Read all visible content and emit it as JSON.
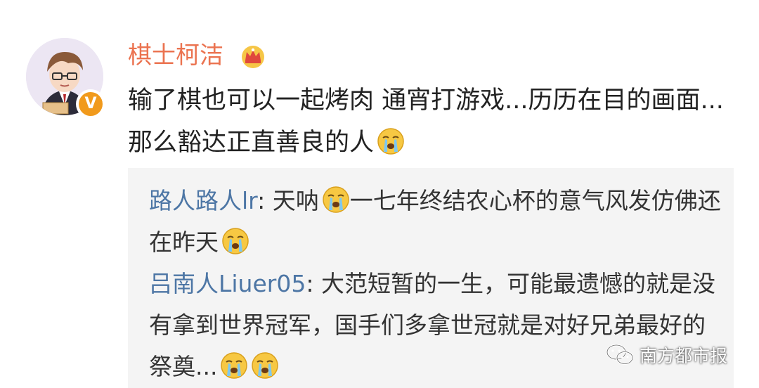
{
  "post": {
    "author": "棋士柯洁",
    "text_1": "输了棋也可以一起烤肉 通宵打游戏...历历在目的画面...那么豁达正直善良的人",
    "verified_mark": "V",
    "emoji_after_text": "crying-emoji"
  },
  "replies": [
    {
      "user": "路人路人lr",
      "sep": ": ",
      "text_a": "天呐",
      "text_b": "一七年终结农心杯的意气风发仿佛还在昨天"
    },
    {
      "user": "吕南人Liuer05",
      "sep": ": ",
      "text_a": "大范短暂的一生，可能最遗憾的就是没有拿到世界冠军，国手们多拿世冠就是对好兄弟最好的祭奠..."
    }
  ],
  "watermark": {
    "text": "南方都市报",
    "icon": "wechat-icon"
  },
  "colors": {
    "username": "#eb7350",
    "reply_user": "#4d76a5",
    "reply_bg": "#f4f4f4",
    "verified": "#f19a1c"
  }
}
